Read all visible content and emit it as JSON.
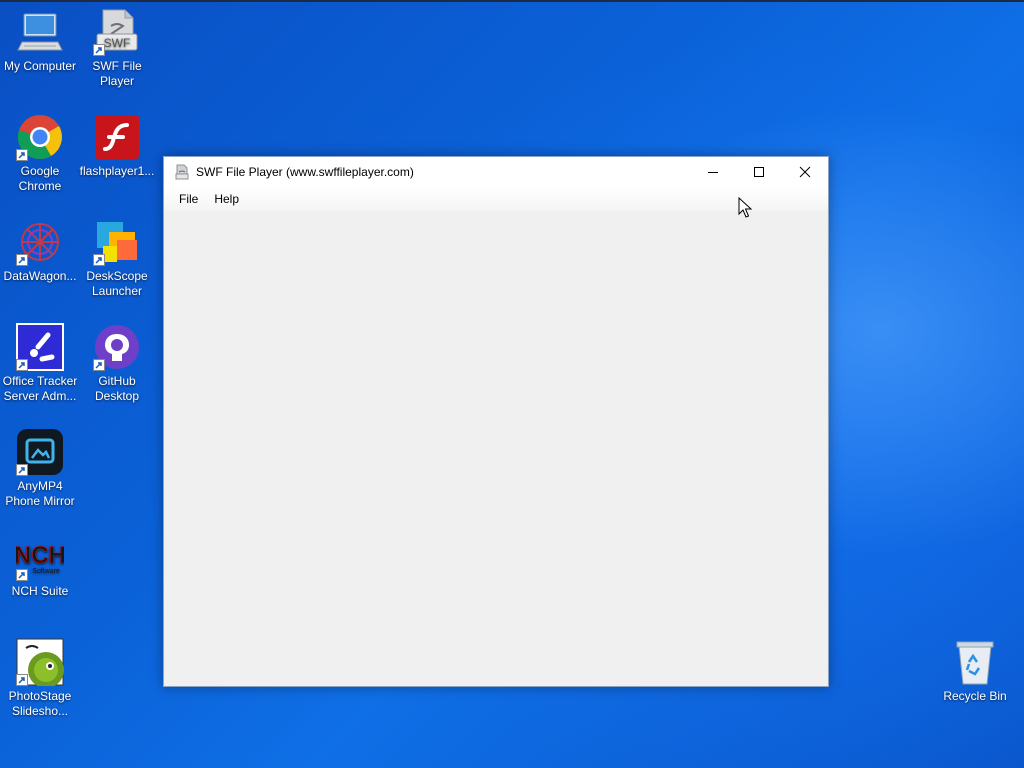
{
  "desktop": {
    "icons": [
      {
        "label": "My Computer",
        "icon": "computer-icon"
      },
      {
        "label": "SWF File Player",
        "icon": "swf-file-icon"
      },
      {
        "label": "Google Chrome",
        "icon": "chrome-icon"
      },
      {
        "label": "flashplayer1...",
        "icon": "flash-icon"
      },
      {
        "label": "DataWagon...",
        "icon": "datawagon-icon"
      },
      {
        "label": "DeskScope Launcher",
        "icon": "deskscope-icon"
      },
      {
        "label": "Office Tracker Server Adm...",
        "icon": "office-tracker-icon"
      },
      {
        "label": "GitHub Desktop",
        "icon": "github-icon"
      },
      {
        "label": "AnyMP4 Phone Mirror",
        "icon": "anymp4-icon"
      },
      {
        "label": "NCH Suite",
        "icon": "nch-icon"
      },
      {
        "label": "PhotoStage Slidesho...",
        "icon": "photostage-icon"
      },
      {
        "label": "Recycle Bin",
        "icon": "recycle-bin-icon"
      }
    ],
    "swf_badge": "SWF",
    "nch_logo": "NCH",
    "nch_sub": "Software"
  },
  "window": {
    "title": "SWF File Player (www.swffileplayer.com)",
    "menu": {
      "file": "File",
      "help": "Help"
    }
  }
}
